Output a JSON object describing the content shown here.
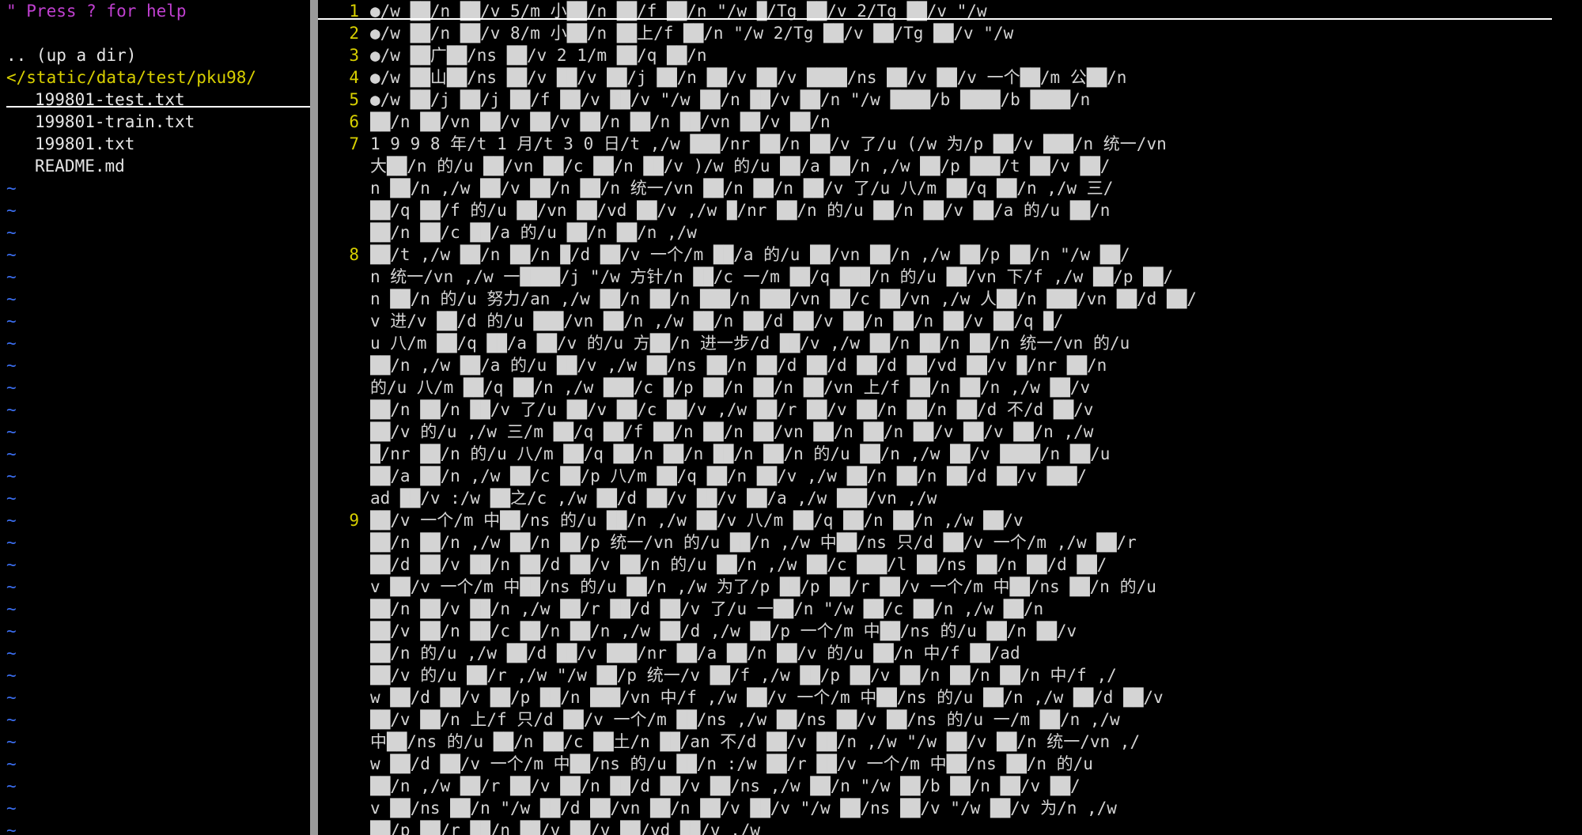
{
  "tree": {
    "help": "\" Press ? for help",
    "blank": "",
    "updir": ".. (up a dir)",
    "cwd": "</static/data/test/pku98/",
    "files": [
      "199801-test.txt",
      "199801-train.txt",
      "199801.txt",
      "README.md"
    ],
    "tilde": "~",
    "tilde_count": 31
  },
  "editor": {
    "lines": [
      {
        "num": "1",
        "text": "●/w ██/n ██/v 5/m 小██/n ██/f ██/n \"/w █/Tg ██/v 2/Tg ██/v \"/w"
      },
      {
        "num": "2",
        "text": "●/w ██/n ██/v 8/m 小██/n ██上/f ██/n \"/w 2/Tg ██/v ██/Tg ██/v \"/w"
      },
      {
        "num": "3",
        "text": "●/w ██广██/ns ██/v 2 1/m ██/q ██/n"
      },
      {
        "num": "4",
        "text": "●/w ██山██/ns ██/v ██/v ██/j ██/n ██/v ██/v ████/ns ██/v ██/v 一个██/m 公██/n"
      },
      {
        "num": "5",
        "text": "●/w ██/j ██/j ██/f ██/v ██/v \"/w ██/n ██/v ██/n \"/w ████/b ████/b ████/n"
      },
      {
        "num": "6",
        "text": "██/n ██/vn ██/v ██/v ██/n ██/n ██/vn ██/v ██/n"
      },
      {
        "num": "7",
        "text": "1 9 9 8 年/t 1 月/t 3 0 日/t ,/w ███/nr ██/n ██/v 了/u (/w 为/p ██/v ███/n 统一/vn"
      },
      {
        "num": "",
        "text": "大██/n 的/u ██/vn ██/c ██/n ██/v )/w 的/u ██/a ██/n ,/w ██/p ███/t ██/v ██/"
      },
      {
        "num": "",
        "text": "n ██/n ,/w ██/v ██/n ██/n 统一/vn ██/n ██/n ██/v 了/u 八/m ██/q ██/n ,/w 三/"
      },
      {
        "num": "",
        "text": "██/q ██/f 的/u ██/vn ██/vd ██/v ,/w █/nr ██/n 的/u ██/n ██/v ██/a 的/u ██/n"
      },
      {
        "num": "",
        "text": "██/n ██/c ██/a 的/u ██/n ██/n ,/w"
      },
      {
        "num": "8",
        "text": "██/t ,/w ██/n ██/n █/d ██/v 一个/m ██/a 的/u ██/vn ██/n ,/w ██/p ██/n \"/w ██/"
      },
      {
        "num": "",
        "text": "n 统一/vn ,/w 一████/j \"/w 方针/n ██/c 一/m ██/q ███/n 的/u ██/vn 下/f ,/w ██/p ██/"
      },
      {
        "num": "",
        "text": "n ██/n 的/u 努力/an ,/w ██/n ██/n ███/n ███/vn ██/c ██/vn ,/w 人██/n ███/vn ██/d ██/"
      },
      {
        "num": "",
        "text": "v 进/v ██/d 的/u ███/vn ██/n ,/w ██/n ██/d ██/v ██/n ██/n ██/v ██/q █/"
      },
      {
        "num": "",
        "text": "u 八/m ██/q ██/a ██/v 的/u 方██/n 进一步/d ██/v ,/w ██/n ██/n ██/n 统一/vn 的/u"
      },
      {
        "num": "",
        "text": "██/n ,/w ██/a 的/u ██/v ,/w ██/ns ██/n ██/d ██/d ██/d ██/vd ██/v █/nr ██/n"
      },
      {
        "num": "",
        "text": "的/u 八/m ██/q ██/n ,/w ███/c █/p ██/n ██/n ██/vn 上/f ██/n ██/n ,/w ██/v"
      },
      {
        "num": "",
        "text": "██/n ██/n ██/v 了/u ██/v ██/c ██/v ,/w ██/r ██/v ██/n ██/n ██/d 不/d ██/v"
      },
      {
        "num": "",
        "text": "██/v 的/u ,/w 三/m ██/q ██/f ██/n ██/n ██/vn ██/n ██/n ██/v ██/v ██/n ,/w"
      },
      {
        "num": "",
        "text": "█/nr ██/n 的/u 八/m ██/q ██/n ██/n ██/n ██/n 的/u ██/n ,/w ██/v ████/n ██/u"
      },
      {
        "num": "",
        "text": "██/a ██/n ,/w ██/c ██/p 八/m ██/q ██/n ██/v ,/w ██/n ██/n ██/d ██/v ███/"
      },
      {
        "num": "",
        "text": "ad ██/v :/w ██之/c ,/w ██/d ██/v ██/v ██/a ,/w ███/vn ,/w"
      },
      {
        "num": "9",
        "text": "██/v 一个/m 中██/ns 的/u ██/n ,/w ██/v 八/m ██/q ██/n ██/n ,/w ██/v"
      },
      {
        "num": "",
        "text": "██/n ██/n ,/w ██/n ██/p 统一/vn 的/u ██/n ,/w 中██/ns 只/d ██/v 一个/m ,/w ██/r"
      },
      {
        "num": "",
        "text": "██/d ██/v ██/n ██/d ██/v ██/n 的/u ██/n ,/w ██/c ███/l ██/ns ██/n ██/d ██/"
      },
      {
        "num": "",
        "text": "v ██/v 一个/m 中██/ns 的/u ██/n ,/w 为了/p ██/p ██/r ██/v 一个/m 中██/ns ██/n 的/u"
      },
      {
        "num": "",
        "text": "██/n ██/v ██/n ,/w ██/r ██/d ██/v 了/u 一██/n \"/w ██/c ██/n ,/w ██/n"
      },
      {
        "num": "",
        "text": "██/v ██/n ██/c ██/n ██/n ,/w ██/d ,/w ██/p 一个/m 中██/ns 的/u ██/n ██/v"
      },
      {
        "num": "",
        "text": "██/n 的/u ,/w ██/d ██/v ███/nr ██/a ██/n ██/v 的/u ██/n 中/f ██/ad"
      },
      {
        "num": "",
        "text": "██/v 的/u ██/r ,/w \"/w ██/p 统一/v ██/f ,/w ██/p ██/v ██/n ██/n ██/n 中/f ,/"
      },
      {
        "num": "",
        "text": "w ██/d ██/v ██/p ██/n ███/vn 中/f ,/w ██/v 一个/m 中██/ns 的/u ██/n ,/w ██/d ██/v"
      },
      {
        "num": "",
        "text": "██/v ██/n 上/f 只/d ██/v 一个/m ██/ns ,/w ██/ns ██/v ██/ns 的/u 一/m ██/n ,/w"
      },
      {
        "num": "",
        "text": "中██/ns 的/u ██/n ██/c ██土/n ██/an 不/d ██/v ██/n ,/w \"/w ██/v ██/n 统一/vn ,/"
      },
      {
        "num": "",
        "text": "w ██/d ██/v 一个/m 中██/ns 的/u ██/n :/w ██/r ██/v 一个/m 中██/ns ██/n 的/u"
      },
      {
        "num": "",
        "text": "██/n ,/w ██/r ██/v ██/n ██/d ██/v ██/ns ,/w ██/n \"/w ██/b ██/n ██/v ██/"
      },
      {
        "num": "",
        "text": "v ██/ns ██/n \"/w ██/d ██/vn ██/n ██/v ██/v \"/w ██/ns ██/v \"/w ██/v 为/n ,/w"
      },
      {
        "num": "",
        "text": "██/p ██/r ██/n ██/v ██/v ██/vd ██/v ,/w"
      }
    ]
  }
}
